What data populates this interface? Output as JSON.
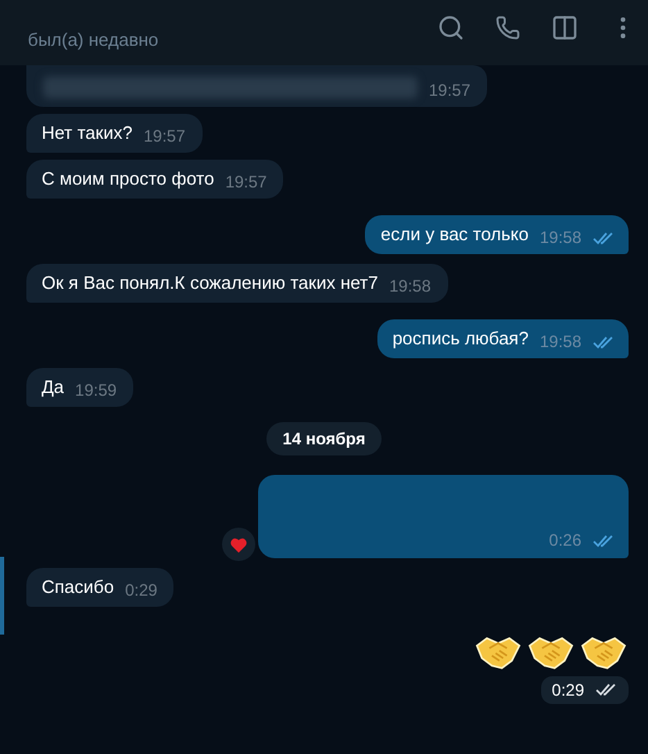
{
  "header": {
    "status": "был(а) недавно"
  },
  "messages": [
    {
      "kind": "blurred",
      "time": "19:57"
    },
    {
      "kind": "incoming",
      "text": "Нет таких?",
      "time": "19:57",
      "highlighted": false
    },
    {
      "kind": "incoming",
      "text": "С моим просто фото",
      "time": "19:57",
      "highlighted": false
    },
    {
      "kind": "outgoing",
      "text": "если у вас только",
      "time": "19:58",
      "read": true
    },
    {
      "kind": "incoming",
      "text": "Ок я Вас понял.К сожалению таких нет7",
      "time": "19:58",
      "highlighted": false
    },
    {
      "kind": "outgoing",
      "text": "роспись любая?",
      "time": "19:58",
      "read": true
    },
    {
      "kind": "incoming",
      "text": "Да",
      "time": "19:59",
      "highlighted": false
    },
    {
      "kind": "date",
      "text": "14 ноября"
    },
    {
      "kind": "outgoing_blank",
      "time": "0:26",
      "read": true,
      "reacted": true
    },
    {
      "kind": "incoming",
      "text": "Спасибо",
      "time": "0:29",
      "highlighted": true
    },
    {
      "kind": "stickers",
      "items": [
        {
          "kind": "handshake"
        },
        {
          "kind": "handshake"
        },
        {
          "kind": "handshake"
        }
      ],
      "time": "0:29",
      "read": true
    }
  ]
}
